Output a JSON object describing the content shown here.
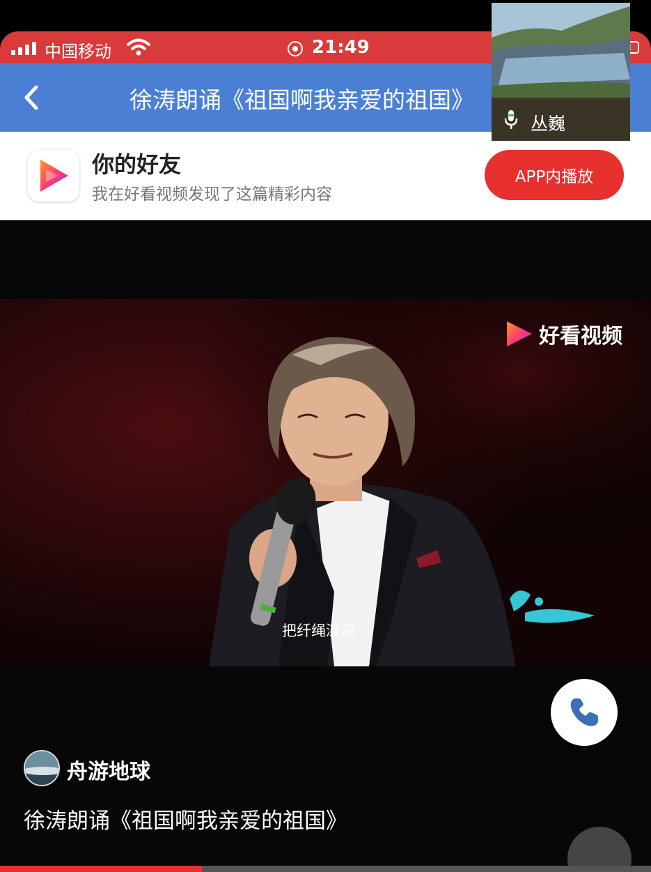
{
  "status_bar": {
    "carrier": "中国移动",
    "time": "21:49",
    "signal_bars": 4
  },
  "nav": {
    "title": "徐涛朗诵《祖国啊我亲爱的祖国》",
    "back_icon": "chevron-left-icon"
  },
  "banner": {
    "title": "你的好友",
    "subtitle": "我在好看视频发现了这篇精彩内容",
    "button_label": "APP内播放"
  },
  "pip_call": {
    "caller_name": "丛巍",
    "icon": "microphone-icon"
  },
  "video": {
    "watermark": "好看视频",
    "subtitle": "把纤绳深深",
    "author": "舟游地球",
    "title": "徐涛朗诵《祖国啊我亲爱的祖国》",
    "progress_percent": 31
  },
  "colors": {
    "status_red": "#d93a3a",
    "nav_blue": "#4a7fd4",
    "accent_red": "#e8302f",
    "call_blue": "#3d6fb6"
  }
}
